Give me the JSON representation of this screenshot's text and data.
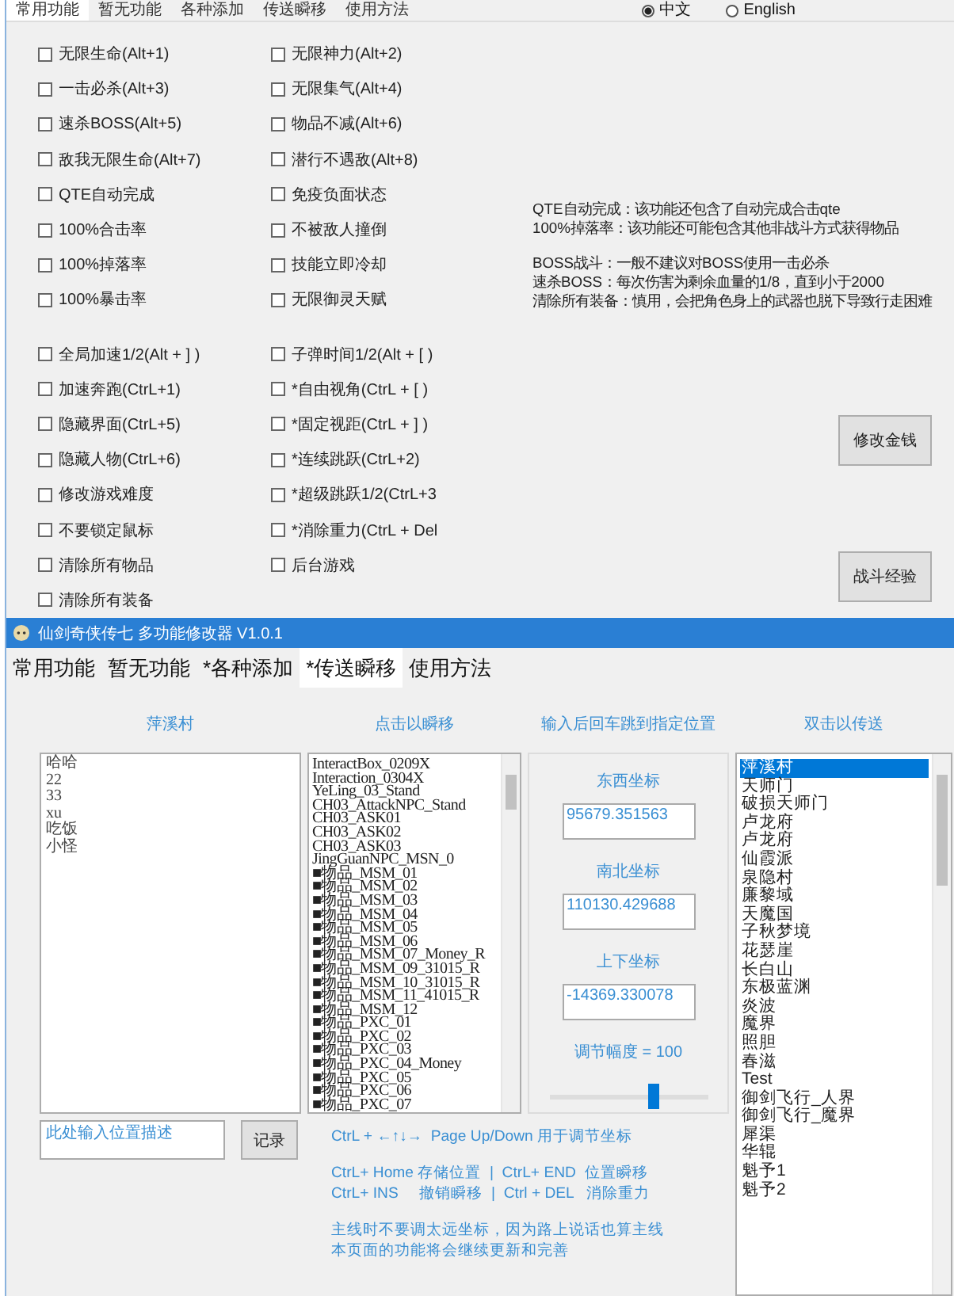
{
  "top_window": {
    "tabs": [
      {
        "label": "常用功能",
        "selected": true
      },
      {
        "label": "暂无功能",
        "selected": false
      },
      {
        "label": "各种添加",
        "selected": false
      },
      {
        "label": "传送瞬移",
        "selected": false
      },
      {
        "label": "使用方法",
        "selected": false
      }
    ],
    "language": [
      {
        "label": "中文",
        "selected": true
      },
      {
        "label": "English",
        "selected": false
      }
    ],
    "option_groups": [
      {
        "options": [
          {
            "label": "无限生命(Alt+1)",
            "checked": false
          },
          {
            "label": "无限神力(Alt+2)",
            "checked": false
          },
          {
            "label": "一击必杀(Alt+3)",
            "checked": false
          },
          {
            "label": "无限集气(Alt+4)",
            "checked": false
          },
          {
            "label": "速杀BOSS(Alt+5)",
            "checked": false
          },
          {
            "label": "物品不减(Alt+6)",
            "checked": false
          },
          {
            "label": "敌我无限生命(Alt+7)",
            "checked": false
          },
          {
            "label": "潜行不遇敌(Alt+8)",
            "checked": false
          },
          {
            "label": "QTE自动完成",
            "checked": false
          },
          {
            "label": "免疫负面状态",
            "checked": false
          },
          {
            "label": "100%合击率",
            "checked": false
          },
          {
            "label": "不被敌人撞倒",
            "checked": false
          },
          {
            "label": "100%掉落率",
            "checked": false
          },
          {
            "label": "技能立即冷却",
            "checked": false
          },
          {
            "label": "100%暴击率",
            "checked": false
          },
          {
            "label": "无限御灵天赋",
            "checked": false
          }
        ]
      },
      {
        "options": [
          {
            "label": "全局加速1/2(Alt + ] )",
            "checked": false
          },
          {
            "label": "子弹时间1/2(Alt + [ )",
            "checked": false
          },
          {
            "label": "加速奔跑(CtrL+1)",
            "checked": false
          },
          {
            "label": "*自由视角(CtrL + [ )",
            "checked": false
          },
          {
            "label": "隐藏界面(CtrL+5)",
            "checked": false
          },
          {
            "label": "*固定视距(CtrL + ] )",
            "checked": false
          },
          {
            "label": "隐藏人物(CtrL+6)",
            "checked": false
          },
          {
            "label": "*连续跳跃(CtrL+2)",
            "checked": false
          },
          {
            "label": "修改游戏难度",
            "checked": false
          },
          {
            "label": "*超级跳跃1/2(CtrL+3",
            "checked": false
          },
          {
            "label": "不要锁定鼠标",
            "checked": false
          },
          {
            "label": "*消除重力(CtrL + Del",
            "checked": false
          },
          {
            "label": "清除所有物品",
            "checked": false
          },
          {
            "label": "后台游戏",
            "checked": false
          },
          {
            "label": "清除所有装备",
            "checked": false
          }
        ]
      }
    ],
    "notes": [
      [
        "QTE自动完成：该功能还包含了自动完成合击qte",
        "100%掉落率：该功能还可能包含其他非战斗方式获得物品"
      ],
      [
        "BOSS战斗：一般不建议对BOSS使用一击必杀",
        "速杀BOSS：每次伤害为剩余血量的1/8，直到小于2000",
        "清除所有装备：慎用，会把角色身上的武器也脱下导致行走困难"
      ]
    ],
    "buttons": [
      "修改金钱",
      "战斗经验"
    ]
  },
  "main_window": {
    "title": "仙剑奇侠传七 多功能修改器 V1.0.1",
    "tabs": [
      {
        "label": "常用功能",
        "selected": false
      },
      {
        "label": "暂无功能",
        "selected": false
      },
      {
        "label": "*各种添加",
        "selected": false
      },
      {
        "label": "*传送瞬移",
        "selected": true
      },
      {
        "label": "使用方法",
        "selected": false
      }
    ],
    "saved_positions": {
      "heading": "萍溪村",
      "items": [
        "哈哈",
        "22",
        "33",
        "xu",
        "吃饭",
        "小怪"
      ],
      "description_field": {
        "placeholder": "此处输入位置描述"
      },
      "record_button": "记录"
    },
    "teleport_points": {
      "heading": "点击以瞬移",
      "items": [
        "InteractBox_0209X",
        "Interaction_0304X",
        "YeLing_03_Stand",
        "CH03_AttackNPC_Stand",
        "CH03_ASK01",
        "CH03_ASK02",
        "CH03_ASK03",
        "JingGuanNPC_MSN_0",
        "■物品_MSM_01",
        "■物品_MSM_02",
        "■物品_MSM_03",
        "■物品_MSM_04",
        "■物品_MSM_05",
        "■物品_MSM_06",
        "■物品_MSM_07_Money_R",
        "■物品_MSM_09_31015_R",
        "■物品_MSM_10_31015_R",
        "■物品_MSM_11_41015_R",
        "■物品_MSM_12",
        "■物品_PXC_01",
        "■物品_PXC_02",
        "■物品_PXC_03",
        "■物品_PXC_04_Money",
        "■物品_PXC_05",
        "■物品_PXC_06",
        "■物品_PXC_07"
      ]
    },
    "coordinates": {
      "heading": "输入后回车跳到指定位置",
      "fields": [
        {
          "label": "东西坐标",
          "value": "95679.351563"
        },
        {
          "label": "南北坐标",
          "value": "110130.429688"
        },
        {
          "label": "上下坐标",
          "value": "-14369.330078"
        }
      ],
      "step_label": "调节幅度 = 100",
      "step_slider": {
        "level": 0.65
      }
    },
    "hint_groups": [
      [
        "CtrL + ←↑↓→  Page Up/Down 用于调节坐标"
      ],
      [
        "CtrL+ Home 存储位置  |  CtrL+ END  位置瞬移",
        "CtrL+ INS     撤销瞬移  |  Ctrl + DEL   消除重力"
      ],
      [
        "主线时不要调太远坐标，因为路上说话也算主线",
        "本页面的功能将会继续更新和完善"
      ]
    ],
    "destinations": {
      "heading": "双击以传送",
      "items": [
        {
          "label": "萍溪村",
          "selected": true
        },
        {
          "label": "天师门",
          "selected": false
        },
        {
          "label": "破损天师门",
          "selected": false
        },
        {
          "label": "卢龙府",
          "selected": false
        },
        {
          "label": "卢龙府",
          "selected": false
        },
        {
          "label": "仙霞派",
          "selected": false
        },
        {
          "label": "泉隐村",
          "selected": false
        },
        {
          "label": "廉黎域",
          "selected": false
        },
        {
          "label": "天魔国",
          "selected": false
        },
        {
          "label": "子秋梦境",
          "selected": false
        },
        {
          "label": "花瑟崖",
          "selected": false
        },
        {
          "label": "长白山",
          "selected": false
        },
        {
          "label": "东极蓝渊",
          "selected": false
        },
        {
          "label": "炎波",
          "selected": false
        },
        {
          "label": "魔界",
          "selected": false
        },
        {
          "label": "照胆",
          "selected": false
        },
        {
          "label": "春滋",
          "selected": false
        },
        {
          "label": "Test",
          "selected": false
        },
        {
          "label": "御剑飞行_人界",
          "selected": false
        },
        {
          "label": "御剑飞行_魔界",
          "selected": false
        },
        {
          "label": "犀渠",
          "selected": false
        },
        {
          "label": "华辊",
          "selected": false
        },
        {
          "label": "魁予1",
          "selected": false
        },
        {
          "label": "魁予2",
          "selected": false
        }
      ]
    }
  }
}
